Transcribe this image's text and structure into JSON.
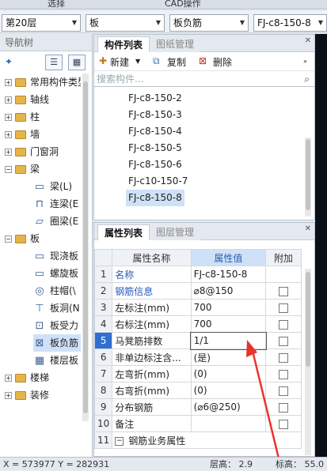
{
  "top": {
    "left_label": "选择",
    "center_label": "CAD操作"
  },
  "selectors": {
    "floor": "第20层",
    "type": "板",
    "subtype": "板负筋",
    "component": "FJ-c8-150-8"
  },
  "nav": {
    "title": "导航树",
    "tree": [
      {
        "label": "常用构件类型",
        "kind": "folder",
        "expanded": false
      },
      {
        "label": "轴线",
        "kind": "folder",
        "expanded": false
      },
      {
        "label": "柱",
        "kind": "folder",
        "expanded": false
      },
      {
        "label": "墙",
        "kind": "folder",
        "expanded": false
      },
      {
        "label": "门窗洞",
        "kind": "folder",
        "expanded": false
      },
      {
        "label": "梁",
        "kind": "folder",
        "expanded": true
      },
      {
        "label": "梁(L)",
        "kind": "item"
      },
      {
        "label": "连梁(E",
        "kind": "item"
      },
      {
        "label": "圈梁(E",
        "kind": "item"
      },
      {
        "label": "板",
        "kind": "folder",
        "expanded": true
      },
      {
        "label": "现浇板",
        "kind": "item"
      },
      {
        "label": "螺旋板",
        "kind": "item"
      },
      {
        "label": "柱帽(\\",
        "kind": "item"
      },
      {
        "label": "板洞(N",
        "kind": "item"
      },
      {
        "label": "板受力",
        "kind": "item"
      },
      {
        "label": "板负筋",
        "kind": "item",
        "selected": true
      },
      {
        "label": "楼层板",
        "kind": "item"
      },
      {
        "label": "楼梯",
        "kind": "folder",
        "expanded": false
      },
      {
        "label": "装修",
        "kind": "folder",
        "expanded": false
      }
    ]
  },
  "component_list": {
    "tabs": [
      "构件列表",
      "图纸管理"
    ],
    "new_label": "新建",
    "copy_label": "复制",
    "delete_label": "删除",
    "search_placeholder": "搜索构件...",
    "items": [
      "FJ-c8-150-2",
      "FJ-c8-150-3",
      "FJ-c8-150-4",
      "FJ-c8-150-5",
      "FJ-c8-150-6",
      "FJ-c10-150-7",
      "FJ-c8-150-8"
    ],
    "selected": "FJ-c8-150-8"
  },
  "properties": {
    "tabs": [
      "属性列表",
      "图层管理"
    ],
    "headers": [
      "属性名称",
      "属性值",
      "附加"
    ],
    "rows": [
      {
        "num": "1",
        "name": "名称",
        "value": "FJ-c8-150-8",
        "blue": true,
        "check": false
      },
      {
        "num": "2",
        "name": "钢筋信息",
        "value": "⌀8@150",
        "blue": true,
        "check": true
      },
      {
        "num": "3",
        "name": "左标注(mm)",
        "value": "700",
        "blue": false,
        "check": true
      },
      {
        "num": "4",
        "name": "右标注(mm)",
        "value": "700",
        "blue": false,
        "check": true
      },
      {
        "num": "5",
        "name": "马凳筋排数",
        "value": "1/1",
        "blue": false,
        "check": true,
        "active": true
      },
      {
        "num": "6",
        "name": "非单边标注含...",
        "value": "(是)",
        "blue": false,
        "check": true
      },
      {
        "num": "7",
        "name": "左弯折(mm)",
        "value": "(0)",
        "blue": false,
        "check": true
      },
      {
        "num": "8",
        "name": "右弯折(mm)",
        "value": "(0)",
        "blue": false,
        "check": true
      },
      {
        "num": "9",
        "name": "分布钢筋",
        "value": "(⌀6@250)",
        "blue": false,
        "check": true
      },
      {
        "num": "10",
        "name": "备注",
        "value": "",
        "blue": false,
        "check": true
      },
      {
        "num": "11",
        "name": "钢筋业务属性",
        "value": "",
        "blue": false,
        "check": false,
        "group": true
      }
    ]
  },
  "status": {
    "coords": "X = 573977 Y = 282931",
    "floor_height": "层高： 2.9",
    "elevation": "标高： 55.0"
  },
  "colors": {
    "accent": "#2858b8",
    "selection": "#cfe1f7",
    "arrow": "#e8342b"
  }
}
